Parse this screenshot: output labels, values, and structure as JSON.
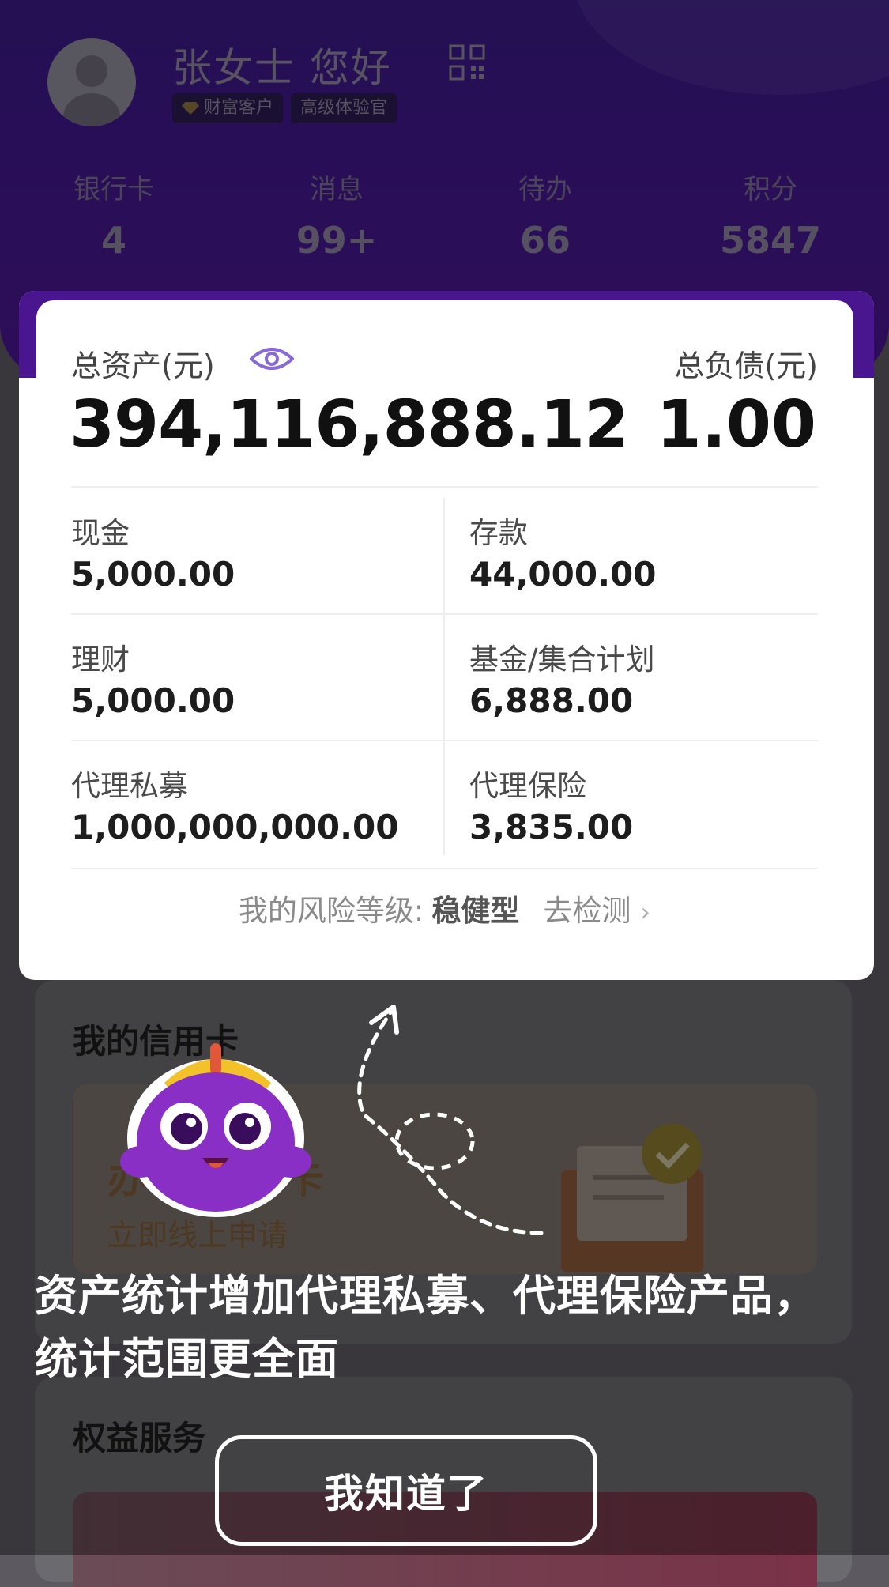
{
  "header": {
    "greeting": "张女士 您好",
    "badges": [
      "财富客户",
      "高级体验官"
    ],
    "stats": [
      {
        "label": "银行卡",
        "value": "4"
      },
      {
        "label": "消息",
        "value": "99+"
      },
      {
        "label": "待办",
        "value": "66"
      },
      {
        "label": "积分",
        "value": "5847"
      }
    ]
  },
  "assets": {
    "total_label": "总资产(元)",
    "total_value": "394,116,888.12",
    "liability_label": "总负债(元)",
    "liability_value": "1.00",
    "items": [
      {
        "label": "现金",
        "value": "5,000.00"
      },
      {
        "label": "存款",
        "value": "44,000.00"
      },
      {
        "label": "理财",
        "value": "5,000.00"
      },
      {
        "label": "基金/集合计划",
        "value": "6,888.00"
      },
      {
        "label": "代理私募",
        "value": "1,000,000,000.00"
      },
      {
        "label": "代理保险",
        "value": "3,835.00"
      }
    ],
    "risk_prefix": "我的风险等级:",
    "risk_level": "稳健型",
    "risk_action": "去检测",
    "risk_chevron": "›"
  },
  "credit": {
    "title": "我的信用卡",
    "big_left": "办",
    "big_right": "卡",
    "sub": "立即线上申请"
  },
  "rights": {
    "title": "权益服务"
  },
  "guide": {
    "tip_line1": "资产统计增加代理私募、代理保险产品，",
    "tip_line2": "统计范围更全面",
    "button": "我知道了"
  },
  "colors": {
    "header_bg": "#45178f",
    "accent_eye": "#8a6bd6",
    "overlay": "rgba(0,0,0,0.38)"
  },
  "icons": [
    "qr-code-icon",
    "diamond-icon",
    "eye-icon",
    "chevron-right-icon",
    "envelope-icon"
  ]
}
